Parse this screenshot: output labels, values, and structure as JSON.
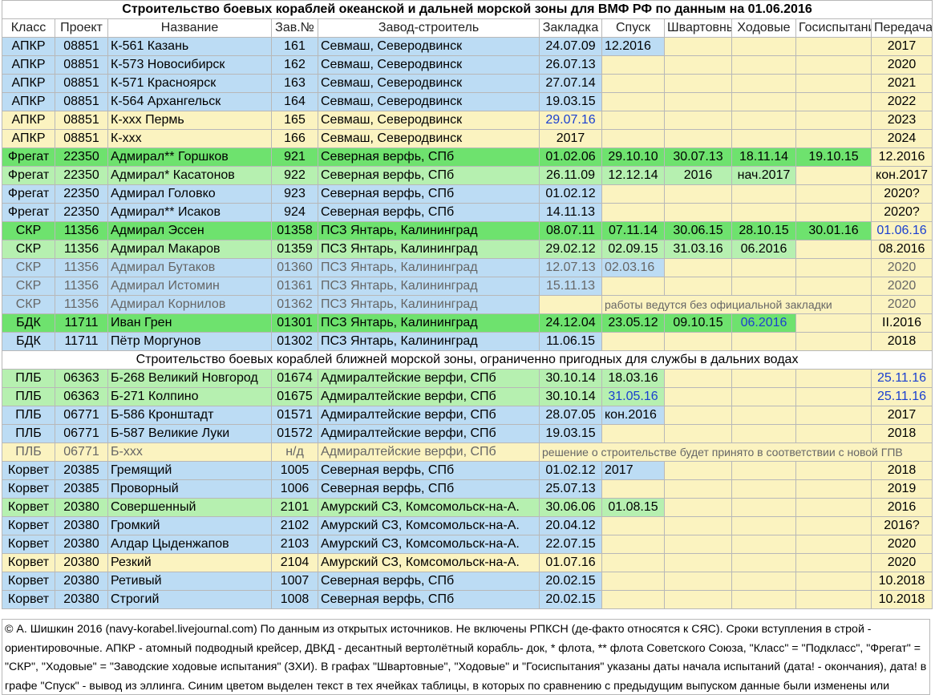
{
  "title": "Строительство боевых кораблей океанской и дальней морской зоны для ВМФ РФ по данным на 01.06.2016",
  "headers": [
    "Класс",
    "Проект",
    "Название",
    "Зав.№",
    "Завод-строитель",
    "Закладка",
    "Спуск",
    "Швартовные",
    "Ходовые",
    "Госиспытани",
    "Передача"
  ],
  "subtitle": "Строительство боевых кораблей ближней морской зоны, ограниченно пригодных для службы в дальних водах",
  "colors": {
    "blue": "#bcdcf4",
    "yellow": "#fbf3c0",
    "green": "#6ee26e",
    "lgreen": "#b6f0b0",
    "changed_text": "#1a3fd0"
  },
  "ships_ocean": [
    {
      "bg": "blue",
      "cls": "АПКР",
      "proj": "08851",
      "name": "К-561 Казань",
      "no": "161",
      "yard": "Севмаш, Северодвинск",
      "laid": "24.07.09",
      "launch": "12.2016",
      "moor": "",
      "sea": "",
      "state": "",
      "deliv": "2017"
    },
    {
      "bg": "blue",
      "cls": "АПКР",
      "proj": "08851",
      "name": "К-573 Новосибирск",
      "no": "162",
      "yard": "Севмаш, Северодвинск",
      "laid": "26.07.13",
      "launch": "",
      "moor": "",
      "sea": "",
      "state": "",
      "deliv": "2020"
    },
    {
      "bg": "blue",
      "cls": "АПКР",
      "proj": "08851",
      "name": "К-571 Красноярск",
      "no": "163",
      "yard": "Севмаш, Северодвинск",
      "laid": "27.07.14",
      "launch": "",
      "moor": "",
      "sea": "",
      "state": "",
      "deliv": "2021"
    },
    {
      "bg": "blue",
      "cls": "АПКР",
      "proj": "08851",
      "name": "К-564 Архангельск",
      "no": "164",
      "yard": "Севмаш, Северодвинск",
      "laid": "19.03.15",
      "launch": "",
      "moor": "",
      "sea": "",
      "state": "",
      "deliv": "2022"
    },
    {
      "bg": "yellow",
      "cls": "АПКР",
      "proj": "08851",
      "name": "К-ххх Пермь",
      "no": "165",
      "yard": "Севмаш, Северодвинск",
      "laid": "29.07.16",
      "launch": "",
      "moor": "",
      "sea": "",
      "state": "",
      "deliv": "2023"
    },
    {
      "bg": "yellow",
      "cls": "АПКР",
      "proj": "08851",
      "name": "К-ххх",
      "no": "166",
      "yard": "Севмаш, Северодвинск",
      "laid": "2017",
      "launch": "",
      "moor": "",
      "sea": "",
      "state": "",
      "deliv": "2024"
    },
    {
      "bg": "green",
      "cls": "Фрегат",
      "proj": "22350",
      "name": "Адмирал** Горшков",
      "no": "921",
      "yard": "Северная верфь, СПб",
      "laid": "01.02.06",
      "launch": "29.10.10",
      "moor": "30.07.13",
      "sea": "18.11.14",
      "state": "19.10.15",
      "deliv": "12.2016"
    },
    {
      "bg": "lgreen",
      "cls": "Фрегат",
      "proj": "22350",
      "name": "Адмирал* Касатонов",
      "no": "922",
      "yard": "Северная верфь, СПб",
      "laid": "26.11.09",
      "launch": "12.12.14",
      "moor": "2016",
      "sea": "нач.2017",
      "state": "",
      "deliv": "кон.2017"
    },
    {
      "bg": "blue",
      "cls": "Фрегат",
      "proj": "22350",
      "name": "Адмирал Головко",
      "no": "923",
      "yard": "Северная верфь, СПб",
      "laid": "01.02.12",
      "launch": "",
      "moor": "",
      "sea": "",
      "state": "",
      "deliv": "2020?"
    },
    {
      "bg": "blue",
      "cls": "Фрегат",
      "proj": "22350",
      "name": "Адмирал** Исаков",
      "no": "924",
      "yard": "Северная верфь, СПб",
      "laid": "14.11.13",
      "launch": "",
      "moor": "",
      "sea": "",
      "state": "",
      "deliv": "2020?"
    },
    {
      "bg": "green",
      "cls": "СКР",
      "proj": "11356",
      "name": "Адмирал Эссен",
      "no": "01358",
      "yard": "ПСЗ Янтарь, Калининград",
      "laid": "08.07.11",
      "launch": "07.11.14",
      "moor": "30.06.15",
      "sea": "28.10.15",
      "state": "30.01.16",
      "deliv": "01.06.16"
    },
    {
      "bg": "lgreen",
      "cls": "СКР",
      "proj": "11356",
      "name": "Адмирал Макаров",
      "no": "01359",
      "yard": "ПСЗ Янтарь, Калининград",
      "laid": "29.02.12",
      "launch": "02.09.15",
      "moor": "31.03.16",
      "sea": "06.2016",
      "state": "",
      "deliv": "08.2016"
    },
    {
      "bg": "blue",
      "cls": "СКР",
      "proj": "11356",
      "name": "Адмирал Бутаков",
      "no": "01360",
      "yard": "ПСЗ Янтарь, Калининград",
      "laid": "12.07.13",
      "launch": "02.03.16",
      "moor": "",
      "sea": "",
      "state": "",
      "deliv": "2020"
    },
    {
      "bg": "blue",
      "cls": "СКР",
      "proj": "11356",
      "name": "Адмирал Истомин",
      "no": "01361",
      "yard": "ПСЗ Янтарь, Калининград",
      "laid": "15.11.13",
      "launch": "",
      "moor": "",
      "sea": "",
      "state": "",
      "deliv": "2020"
    },
    {
      "bg": "blue",
      "cls": "СКР",
      "proj": "11356",
      "name": "Адмирал Корнилов",
      "no": "01362",
      "yard": "ПСЗ Янтарь, Калининград",
      "laid": "",
      "note": "работы ведутся без официальной закладки",
      "deliv": "2020"
    },
    {
      "bg": "green",
      "cls": "БДК",
      "proj": "11711",
      "name": "Иван Грен",
      "no": "01301",
      "yard": "ПСЗ Янтарь, Калининград",
      "laid": "24.12.04",
      "launch": "23.05.12",
      "moor": "09.10.15",
      "sea": "06.2016",
      "state": "",
      "deliv": "II.2016"
    },
    {
      "bg": "blue",
      "cls": "БДК",
      "proj": "11711",
      "name": "Пётр Моргунов",
      "no": "01302",
      "yard": "ПСЗ Янтарь, Калининград",
      "laid": "11.06.15",
      "launch": "",
      "moor": "",
      "sea": "",
      "state": "",
      "deliv": "2018"
    }
  ],
  "ships_coastal": [
    {
      "bg": "lgreen",
      "cls": "ПЛБ",
      "proj": "06363",
      "name": "Б-268 Великий Новгород",
      "no": "01674",
      "yard": "Адмиралтейские верфи, СПб",
      "laid": "30.10.14",
      "launch": "18.03.16",
      "moor": "",
      "sea": "",
      "state": "",
      "deliv": "25.11.16"
    },
    {
      "bg": "lgreen",
      "cls": "ПЛБ",
      "proj": "06363",
      "name": "Б-271 Колпино",
      "no": "01675",
      "yard": "Адмиралтейские верфи, СПб",
      "laid": "30.10.14",
      "launch": "31.05.16",
      "moor": "",
      "sea": "",
      "state": "",
      "deliv": "25.11.16"
    },
    {
      "bg": "blue",
      "cls": "ПЛБ",
      "proj": "06771",
      "name": "Б-586 Кронштадт",
      "no": "01571",
      "yard": "Адмиралтейские верфи, СПб",
      "laid": "28.07.05",
      "launch": "кон.2016",
      "moor": "",
      "sea": "",
      "state": "",
      "deliv": "2017"
    },
    {
      "bg": "blue",
      "cls": "ПЛБ",
      "proj": "06771",
      "name": "Б-587 Великие Луки",
      "no": "01572",
      "yard": "Адмиралтейские верфи, СПб",
      "laid": "19.03.15",
      "launch": "",
      "moor": "",
      "sea": "",
      "state": "",
      "deliv": "2018"
    },
    {
      "bg": "yellow",
      "cls": "ПЛБ",
      "proj": "06771",
      "name": "Б-ххх",
      "no": "н/д",
      "yard": "Адмиралтейские верфи, СПб",
      "note": "решение о строительстве будет принято в соответствии с новой ГПВ"
    },
    {
      "bg": "blue",
      "cls": "Корвет",
      "proj": "20385",
      "name": "Гремящий",
      "no": "1005",
      "yard": "Северная верфь, СПб",
      "laid": "01.02.12",
      "launch": "2017",
      "moor": "",
      "sea": "",
      "state": "",
      "deliv": "2018"
    },
    {
      "bg": "blue",
      "cls": "Корвет",
      "proj": "20385",
      "name": "Проворный",
      "no": "1006",
      "yard": "Северная верфь, СПб",
      "laid": "25.07.13",
      "launch": "",
      "moor": "",
      "sea": "",
      "state": "",
      "deliv": "2019"
    },
    {
      "bg": "lgreen",
      "cls": "Корвет",
      "proj": "20380",
      "name": "Совершенный",
      "no": "2101",
      "yard": "Амурский СЗ, Комсомольск-на-А.",
      "laid": "30.06.06",
      "launch": "01.08.15",
      "moor": "",
      "sea": "",
      "state": "",
      "deliv": "2016"
    },
    {
      "bg": "blue",
      "cls": "Корвет",
      "proj": "20380",
      "name": "Громкий",
      "no": "2102",
      "yard": "Амурский СЗ, Комсомольск-на-А.",
      "laid": "20.04.12",
      "launch": "",
      "moor": "",
      "sea": "",
      "state": "",
      "deliv": "2016?"
    },
    {
      "bg": "blue",
      "cls": "Корвет",
      "proj": "20380",
      "name": "Алдар Цыденжапов",
      "no": "2103",
      "yard": "Амурский СЗ, Комсомольск-на-А.",
      "laid": "22.07.15",
      "launch": "",
      "moor": "",
      "sea": "",
      "state": "",
      "deliv": "2020"
    },
    {
      "bg": "yellow",
      "cls": "Корвет",
      "proj": "20380",
      "name": "Резкий",
      "no": "2104",
      "yard": "Амурский СЗ, Комсомольск-на-А.",
      "laid": "01.07.16",
      "launch": "",
      "moor": "",
      "sea": "",
      "state": "",
      "deliv": "2020"
    },
    {
      "bg": "blue",
      "cls": "Корвет",
      "proj": "20380",
      "name": "Ретивый",
      "no": "1007",
      "yard": "Северная верфь, СПб",
      "laid": "20.02.15",
      "launch": "",
      "moor": "",
      "sea": "",
      "state": "",
      "deliv": "10.2018"
    },
    {
      "bg": "blue",
      "cls": "Корвет",
      "proj": "20380",
      "name": "Строгий",
      "no": "1008",
      "yard": "Северная верфь, СПб",
      "laid": "20.02.15",
      "launch": "",
      "moor": "",
      "sea": "",
      "state": "",
      "deliv": "10.2018"
    }
  ],
  "footer": "© А. Шишкин 2016 (navy-korabel.livejournal.com)    По данным из открытых источников. Не включены РПКСН (де-факто относятся к СЯС). Сроки вступления в строй - ориентировочные. АПКР - атомный подводный крейсер, ДВКД - десантный вертолётный корабль- док, * флота, ** флота Советского Союза, \"Класс\" = \"Подкласс\", \"Фрегат\" = \"СКР\", \"Ходовые\" = \"Заводские ходовые испытания\" (ЗХИ). В графах \"Швартовные\", \"Ходовые\" и \"Госиспытания\" указаны даты начала испытаний (дата! - окончания), дата! в графе \"Спуск\" - вывод из эллинга. Синим цветом выделен текст в тех ячейках таблицы, в которых по сравнению с предыдущим выпуском данные были изменены или подтверждены."
}
